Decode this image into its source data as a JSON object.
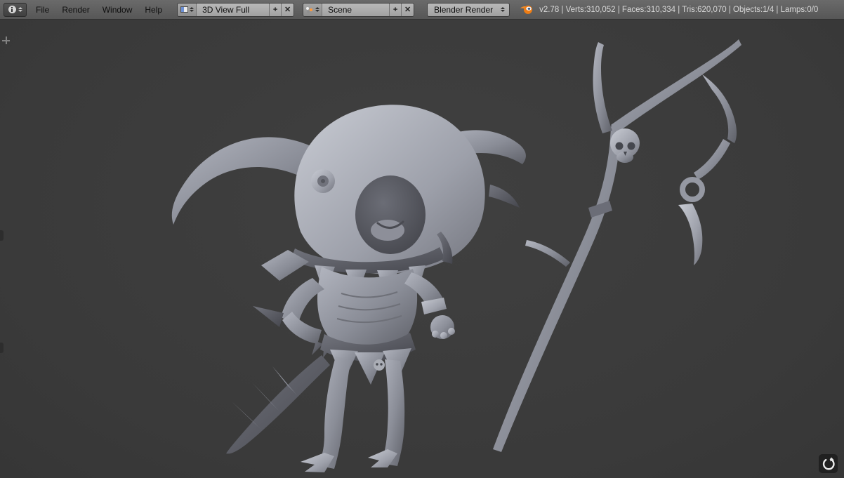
{
  "header": {
    "menus": [
      {
        "label": "File"
      },
      {
        "label": "Render"
      },
      {
        "label": "Window"
      },
      {
        "label": "Help"
      }
    ],
    "layout": {
      "value": "3D View Full",
      "add": "+",
      "close": "✕"
    },
    "scene": {
      "value": "Scene",
      "add": "+",
      "close": "✕"
    },
    "engine": {
      "value": "Blender Render"
    },
    "stats": "v2.78 | Verts:310,052 | Faces:310,334 | Tris:620,070 | Objects:1/4 | Lamps:0/0"
  },
  "icons": {
    "editor_type": "info-editor-icon",
    "layout_browse": "screen-layout-icon",
    "scene_browse": "scene-icon",
    "add": "plus-icon",
    "close": "x-icon",
    "engine_arrows": "double-arrow-icon",
    "blender": "blender-logo",
    "corner_handle": "region-split-handle",
    "screencast": "circular-arrow-icon"
  },
  "viewport": {
    "background": "#3c3c3c",
    "objects": [
      {
        "name": "chibi-demon-character-sculpt"
      },
      {
        "name": "skull-staff-sculpt"
      }
    ]
  },
  "colors": {
    "header_bg": "#5e5e5e",
    "field_bg": "#adadad",
    "viewport_bg": "#3c3c3c",
    "blender_orange": "#ee8420",
    "model_gray": "#9b9ea8",
    "stats_text": "#d8d8d8"
  }
}
